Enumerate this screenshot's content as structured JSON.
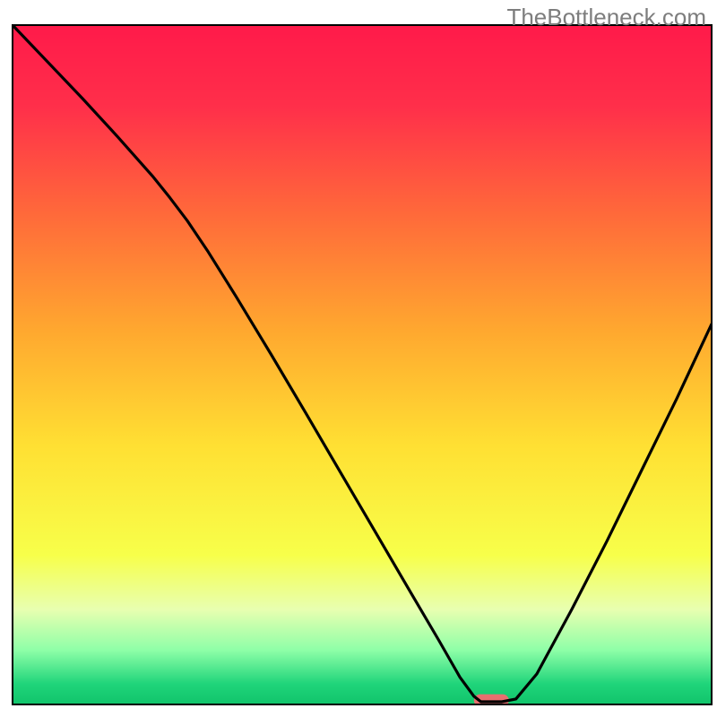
{
  "watermark": "TheBottleneck.com",
  "chart_data": {
    "type": "line",
    "title": "",
    "xlabel": "",
    "ylabel": "",
    "axes_visible": false,
    "grid": false,
    "background_gradient": {
      "stops": [
        {
          "offset": 0.0,
          "color": "#ff1a4a"
        },
        {
          "offset": 0.12,
          "color": "#ff2f4a"
        },
        {
          "offset": 0.28,
          "color": "#ff6a3a"
        },
        {
          "offset": 0.45,
          "color": "#ffa82f"
        },
        {
          "offset": 0.62,
          "color": "#ffe033"
        },
        {
          "offset": 0.78,
          "color": "#f7ff4a"
        },
        {
          "offset": 0.86,
          "color": "#e8ffb0"
        },
        {
          "offset": 0.92,
          "color": "#8effa8"
        },
        {
          "offset": 0.97,
          "color": "#1fd47a"
        },
        {
          "offset": 1.0,
          "color": "#11c46b"
        }
      ]
    },
    "curve": {
      "description": "V-shaped bottleneck curve with a flat minimum segment near x≈0.68",
      "x_range": [
        0,
        1
      ],
      "y_range": [
        0,
        1
      ],
      "points": [
        {
          "x": 0.0,
          "y": 1.0
        },
        {
          "x": 0.05,
          "y": 0.946
        },
        {
          "x": 0.1,
          "y": 0.892
        },
        {
          "x": 0.15,
          "y": 0.836
        },
        {
          "x": 0.2,
          "y": 0.778
        },
        {
          "x": 0.225,
          "y": 0.746
        },
        {
          "x": 0.25,
          "y": 0.712
        },
        {
          "x": 0.28,
          "y": 0.666
        },
        {
          "x": 0.32,
          "y": 0.6
        },
        {
          "x": 0.37,
          "y": 0.515
        },
        {
          "x": 0.42,
          "y": 0.428
        },
        {
          "x": 0.47,
          "y": 0.34
        },
        {
          "x": 0.52,
          "y": 0.252
        },
        {
          "x": 0.57,
          "y": 0.164
        },
        {
          "x": 0.61,
          "y": 0.094
        },
        {
          "x": 0.64,
          "y": 0.04
        },
        {
          "x": 0.66,
          "y": 0.012
        },
        {
          "x": 0.67,
          "y": 0.004
        },
        {
          "x": 0.7,
          "y": 0.004
        },
        {
          "x": 0.72,
          "y": 0.008
        },
        {
          "x": 0.75,
          "y": 0.045
        },
        {
          "x": 0.8,
          "y": 0.14
        },
        {
          "x": 0.85,
          "y": 0.24
        },
        {
          "x": 0.9,
          "y": 0.345
        },
        {
          "x": 0.95,
          "y": 0.45
        },
        {
          "x": 1.0,
          "y": 0.56
        }
      ]
    },
    "marker": {
      "shape": "rounded-rect",
      "color": "#e86f6f",
      "x": 0.685,
      "y": 0.006,
      "width_frac": 0.05,
      "height_frac": 0.018
    },
    "frame": {
      "left": 0.0175,
      "right": 0.9925,
      "top": 0.035,
      "bottom": 0.9825,
      "stroke": "#000000",
      "stroke_width": 2
    }
  }
}
